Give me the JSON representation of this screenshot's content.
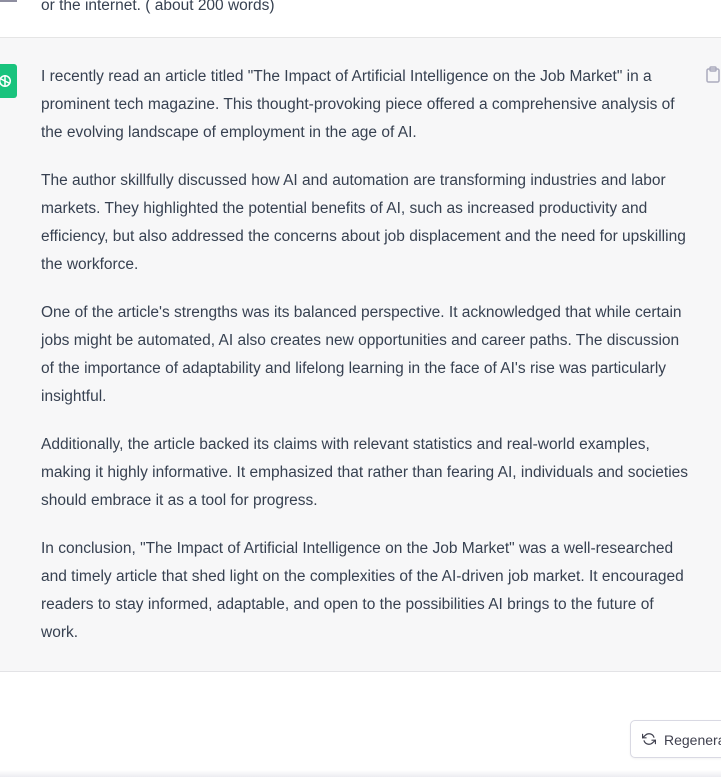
{
  "conversation": {
    "user_message_tail": "or the internet. ( about 200 words)",
    "assistant_paragraphs": [
      "I recently read an article titled \"The Impact of Artificial Intelligence on the Job Market\" in a prominent tech magazine. This thought-provoking piece offered a comprehensive analysis of the evolving landscape of employment in the age of AI.",
      "The author skillfully discussed how AI and automation are transforming industries and labor markets. They highlighted the potential benefits of AI, such as increased productivity and efficiency, but also addressed the concerns about job displacement and the need for upskilling the workforce.",
      "One of the article's strengths was its balanced perspective. It acknowledged that while certain jobs might be automated, AI also creates new opportunities and career paths. The discussion of the importance of adaptability and lifelong learning in the face of AI's rise was particularly insightful.",
      "Additionally, the article backed its claims with relevant statistics and real-world examples, making it highly informative. It emphasized that rather than fearing AI, individuals and societies should embrace it as a tool for progress.",
      "In conclusion, \"The Impact of Artificial Intelligence on the Job Market\" was a well-researched and timely article that shed light on the complexities of the AI-driven job market. It encouraged readers to stay informed, adaptable, and open to the possibilities AI brings to the future of work."
    ]
  },
  "actions": {
    "regenerate_label": "Regenerate response"
  },
  "icons": {
    "assistant_avatar": "openai-logo-icon",
    "copy": "clipboard-icon",
    "regenerate": "refresh-icon"
  },
  "colors": {
    "assistant_avatar_bg": "#19c37d",
    "assistant_bg": "#f7f7f8",
    "text": "#374151"
  }
}
